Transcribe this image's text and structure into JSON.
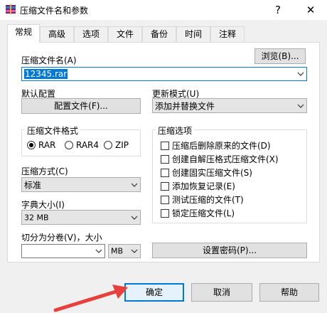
{
  "window": {
    "title": "压缩文件名和参数",
    "help_glyph": "?",
    "close_glyph": "✕"
  },
  "tabs": [
    {
      "label": "常规"
    },
    {
      "label": "高级"
    },
    {
      "label": "选项"
    },
    {
      "label": "文件"
    },
    {
      "label": "备份"
    },
    {
      "label": "时间"
    },
    {
      "label": "注释"
    }
  ],
  "archive": {
    "label": "压缩文件名(A)",
    "browse_label": "浏览(B)...",
    "value": "12345.rar"
  },
  "profile": {
    "label": "默认配置",
    "button_label": "配置文件(F)..."
  },
  "update_mode": {
    "label": "更新模式(U)",
    "value": "添加并替换文件"
  },
  "format": {
    "label": "压缩文件格式",
    "options": [
      "RAR",
      "RAR4",
      "ZIP"
    ],
    "selected": "RAR"
  },
  "method": {
    "label": "压缩方式(C)",
    "value": "标准"
  },
  "dict": {
    "label": "字典大小(I)",
    "value": "32 MB"
  },
  "split": {
    "label": "切分为分卷(V)，大小",
    "value": "",
    "unit": "MB"
  },
  "options": {
    "label": "压缩选项",
    "items": [
      "压缩后删除原来的文件(D)",
      "创建自解压格式压缩文件(X)",
      "创建固实压缩文件(S)",
      "添加恢复记录(E)",
      "测试压缩的文件(T)",
      "锁定压缩文件(L)"
    ]
  },
  "password_button": "设置密码(P)...",
  "buttons": {
    "ok": "确定",
    "cancel": "取消",
    "help": "帮助"
  },
  "colors": {
    "accent": "#0078d7",
    "arrow": "#e8413d"
  }
}
